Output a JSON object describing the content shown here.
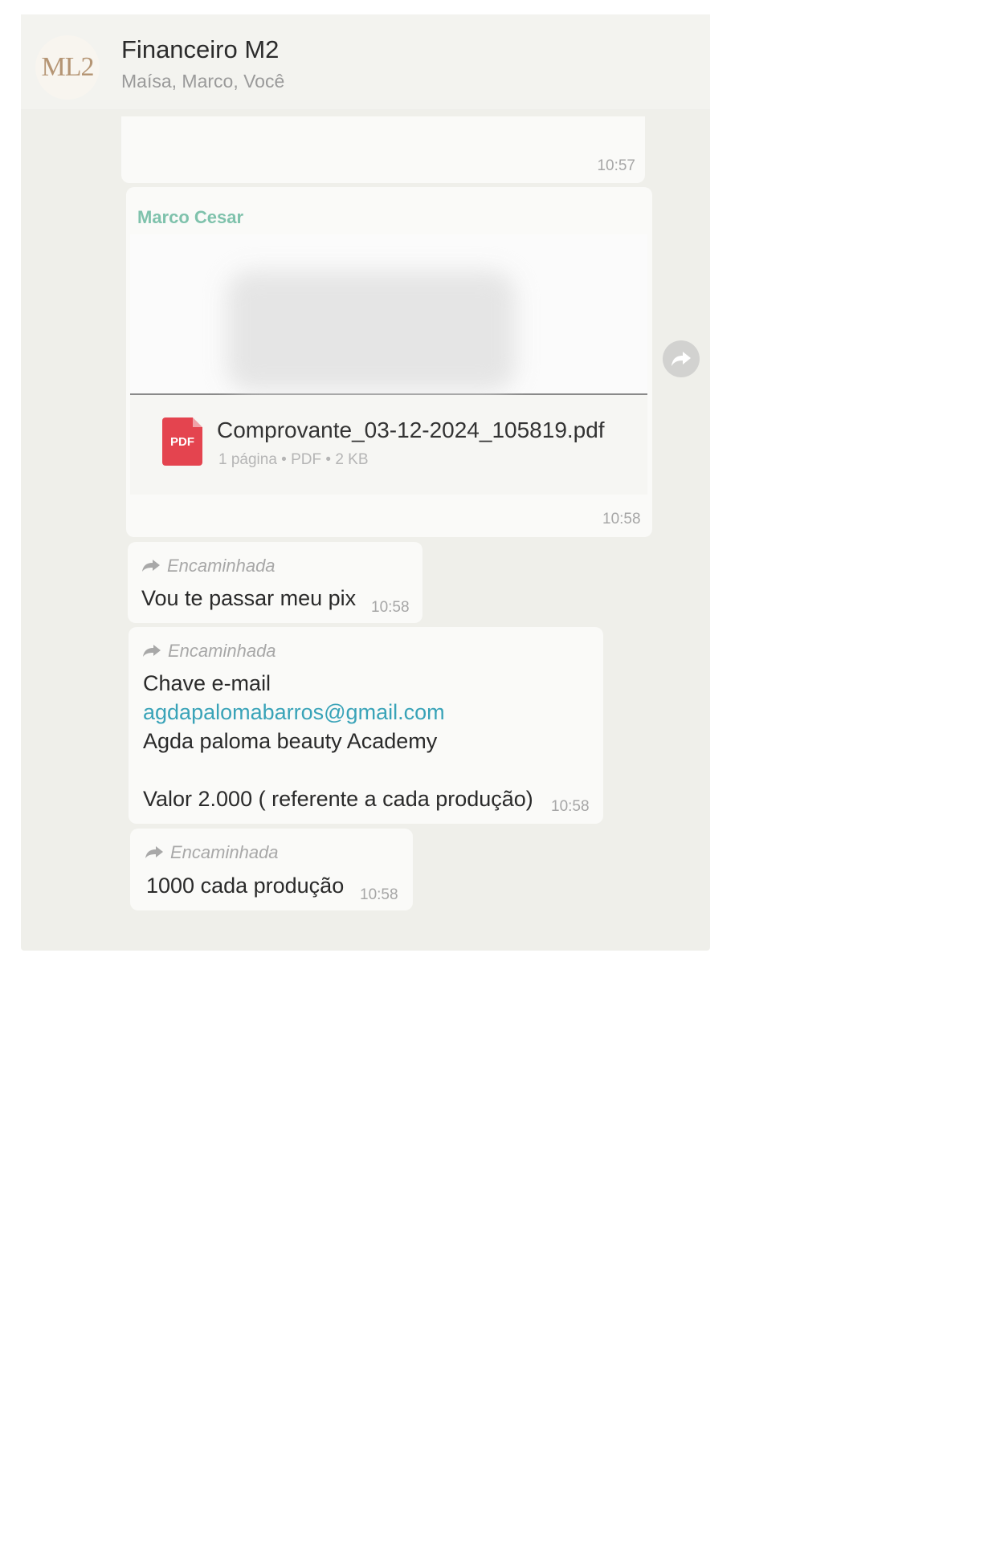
{
  "chat": {
    "avatar_text": "ML2",
    "title": "Financeiro M2",
    "participants": "Maísa, Marco, Você"
  },
  "messages": {
    "m1": {
      "time": "10:57"
    },
    "m2": {
      "sender": "Marco Cesar",
      "file_icon": "PDF",
      "file_name": "Comprovante_03-12-2024_105819.pdf",
      "file_meta": "1 página • PDF • 2 KB",
      "time": "10:58"
    },
    "m3": {
      "forwarded": "Encaminhada",
      "text": "Vou te passar meu pix",
      "time": "10:58"
    },
    "m4": {
      "forwarded": "Encaminhada",
      "line1": "Chave e-mail",
      "email": "agdapalomabarros@gmail.com",
      "line3": "Agda paloma beauty Academy",
      "line5": "Valor 2.000 ( referente a cada produção)",
      "time": "10:58"
    },
    "m5": {
      "forwarded": "Encaminhada",
      "text": "1000 cada produção",
      "time": "10:58"
    }
  },
  "icons": {
    "forward": "forward-arrow-icon",
    "pdf": "pdf-file-icon",
    "share": "share-icon"
  }
}
